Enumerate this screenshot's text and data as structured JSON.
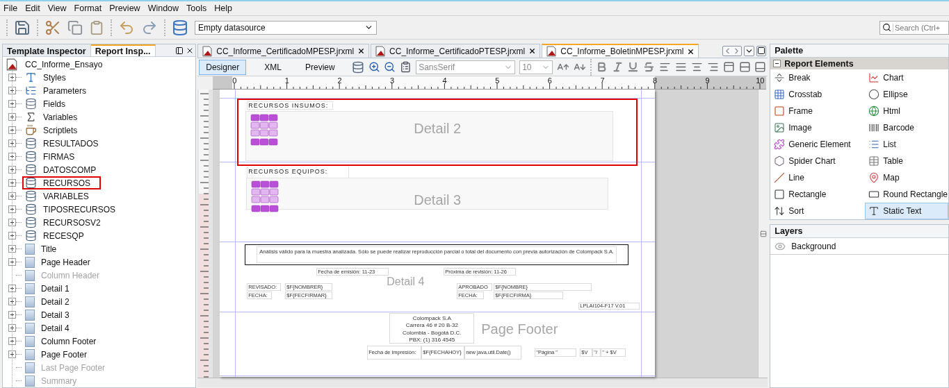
{
  "menu": [
    "File",
    "Edit",
    "View",
    "Format",
    "Preview",
    "Window",
    "Tools",
    "Help"
  ],
  "toolbar": {
    "datasource": "Empty datasource",
    "search_placeholder": "Search (Ctrl+"
  },
  "inspector": {
    "tabs": [
      {
        "label": "Template Inspector",
        "selected": false
      },
      {
        "label": "Report Insp...",
        "selected": true
      }
    ],
    "root": "CC_Informe_Ensayo",
    "items": [
      {
        "label": "Styles",
        "kind": "styles",
        "disabled": false,
        "highlighted": false
      },
      {
        "label": "Parameters",
        "kind": "parameters",
        "disabled": false,
        "highlighted": false
      },
      {
        "label": "Fields",
        "kind": "fields",
        "disabled": false,
        "highlighted": false
      },
      {
        "label": "Variables",
        "kind": "variables",
        "disabled": false,
        "highlighted": false
      },
      {
        "label": "Scriptlets",
        "kind": "scriptlets",
        "disabled": false,
        "highlighted": false
      },
      {
        "label": "RESULTADOS",
        "kind": "dataset",
        "disabled": false,
        "highlighted": false
      },
      {
        "label": "FIRMAS",
        "kind": "dataset",
        "disabled": false,
        "highlighted": false
      },
      {
        "label": "DATOSCOMP",
        "kind": "dataset",
        "disabled": false,
        "highlighted": false
      },
      {
        "label": "RECURSOS",
        "kind": "dataset",
        "disabled": false,
        "highlighted": true
      },
      {
        "label": "VARIABLES",
        "kind": "dataset",
        "disabled": false,
        "highlighted": false
      },
      {
        "label": "TIPOSRECURSOS",
        "kind": "dataset",
        "disabled": false,
        "highlighted": false
      },
      {
        "label": "RECURSOSV2",
        "kind": "dataset",
        "disabled": false,
        "highlighted": false
      },
      {
        "label": "RECESQP",
        "kind": "dataset",
        "disabled": false,
        "highlighted": false
      },
      {
        "label": "Title",
        "kind": "band",
        "disabled": false,
        "highlighted": false
      },
      {
        "label": "Page Header",
        "kind": "band",
        "disabled": false,
        "highlighted": false
      },
      {
        "label": "Column Header",
        "kind": "band",
        "disabled": true,
        "highlighted": false
      },
      {
        "label": "Detail 1",
        "kind": "band",
        "disabled": false,
        "highlighted": false
      },
      {
        "label": "Detail 2",
        "kind": "band",
        "disabled": false,
        "highlighted": false
      },
      {
        "label": "Detail 3",
        "kind": "band",
        "disabled": false,
        "highlighted": false
      },
      {
        "label": "Detail 4",
        "kind": "band",
        "disabled": false,
        "highlighted": false
      },
      {
        "label": "Column Footer",
        "kind": "band",
        "disabled": false,
        "highlighted": false
      },
      {
        "label": "Page Footer",
        "kind": "band",
        "disabled": false,
        "highlighted": false
      },
      {
        "label": "Last Page Footer",
        "kind": "band",
        "disabled": true,
        "highlighted": false
      },
      {
        "label": "Summary",
        "kind": "band",
        "disabled": true,
        "highlighted": false
      }
    ]
  },
  "editor": {
    "files": [
      {
        "label": "CC_Informe_CertificadoMPESP.jrxml",
        "selected": false
      },
      {
        "label": "CC_Informe_CertificadoPTESP.jrxml",
        "selected": false
      },
      {
        "label": "CC_Informe_BoletinMPESP.jrxml",
        "selected": true
      }
    ],
    "views": [
      {
        "label": "Designer",
        "selected": true
      },
      {
        "label": "XML",
        "selected": false
      },
      {
        "label": "Preview",
        "selected": false
      }
    ],
    "font": "SansSerif",
    "font_size": "10",
    "ruler": [
      "0",
      "1",
      "2",
      "3",
      "4",
      "5",
      "6",
      "7",
      "8",
      "9",
      "10"
    ],
    "bands": [
      {
        "name": "Detail 2",
        "highlighted": true,
        "elements": [
          {
            "kind": "heading",
            "text": "RECURSOS INSUMOS:"
          },
          {
            "kind": "subreport"
          }
        ]
      },
      {
        "name": "Detail 3",
        "highlighted": false,
        "elements": [
          {
            "kind": "heading",
            "text": "RECURSOS EQUIPOS:"
          },
          {
            "kind": "subreport"
          }
        ]
      },
      {
        "name": "Detail 4",
        "highlighted": false,
        "elements": [
          {
            "kind": "frame",
            "text": "Análisis válido para la muestra analizada. Sólo se puede realizar reproducción parcial o total del documento con previa autorización de Colompack S.A."
          },
          {
            "kind": "text",
            "text": "Fecha de emisión: 11-23"
          },
          {
            "kind": "text",
            "text": "Próxima de revisión: 11-26"
          },
          {
            "kind": "text",
            "text": "REVISADO:"
          },
          {
            "kind": "text",
            "text": "$F{NOMBRER}"
          },
          {
            "kind": "text",
            "text": "FECHA:"
          },
          {
            "kind": "text",
            "text": "$F{FECFIRMAR}"
          },
          {
            "kind": "text",
            "text": "APROBADO"
          },
          {
            "kind": "text",
            "text": "$F{NOMBRE}"
          },
          {
            "kind": "text",
            "text": "FECHA:"
          },
          {
            "kind": "text",
            "text": "$F{FECFIRMA}"
          },
          {
            "kind": "text",
            "text": "LPLAI104-F17 V.01"
          }
        ]
      },
      {
        "name": "Page Footer",
        "highlighted": false,
        "elements": [
          {
            "kind": "block",
            "lines": [
              "Colompack S.A",
              "Carrera 46 # 20 B-32",
              "Colombia - Bogotá D.C.",
              "PBX: (1) 316 4545"
            ]
          },
          {
            "kind": "text",
            "text": "Fecha de impresión:"
          },
          {
            "kind": "text",
            "text": "$F{FECHAHOY}"
          },
          {
            "kind": "text",
            "text": "new java.util.Date()"
          },
          {
            "kind": "text",
            "text": "\"Página \""
          },
          {
            "kind": "text",
            "text": "$V"
          },
          {
            "kind": "text",
            "text": "\"/"
          },
          {
            "kind": "text",
            "text": "\" + $V"
          }
        ]
      }
    ]
  },
  "palette": {
    "title": "Palette",
    "section": {
      "label": "Report Elements",
      "expanded": true
    },
    "items": [
      {
        "label": "Break",
        "kind": "break",
        "selected": false
      },
      {
        "label": "Chart",
        "kind": "chart",
        "selected": false
      },
      {
        "label": "Crosstab",
        "kind": "crosstab",
        "selected": false
      },
      {
        "label": "Ellipse",
        "kind": "ellipse",
        "selected": false
      },
      {
        "label": "Frame",
        "kind": "frame",
        "selected": false
      },
      {
        "label": "Html",
        "kind": "html",
        "selected": false
      },
      {
        "label": "Image",
        "kind": "image",
        "selected": false
      },
      {
        "label": "Barcode",
        "kind": "barcode",
        "selected": false
      },
      {
        "label": "Generic Element",
        "kind": "generic",
        "selected": false
      },
      {
        "label": "List",
        "kind": "list",
        "selected": false
      },
      {
        "label": "Spider Chart",
        "kind": "spider",
        "selected": false
      },
      {
        "label": "Table",
        "kind": "table",
        "selected": false
      },
      {
        "label": "Line",
        "kind": "line",
        "selected": false
      },
      {
        "label": "Map",
        "kind": "map",
        "selected": false
      },
      {
        "label": "Rectangle",
        "kind": "rectangle",
        "selected": false
      },
      {
        "label": "Round Rectangle",
        "kind": "roundrect",
        "selected": false
      },
      {
        "label": "Sort",
        "kind": "sort",
        "selected": false
      },
      {
        "label": "Static Text",
        "kind": "statictext",
        "selected": true
      }
    ]
  },
  "layers": {
    "title": "Layers",
    "items": [
      "Background"
    ]
  }
}
